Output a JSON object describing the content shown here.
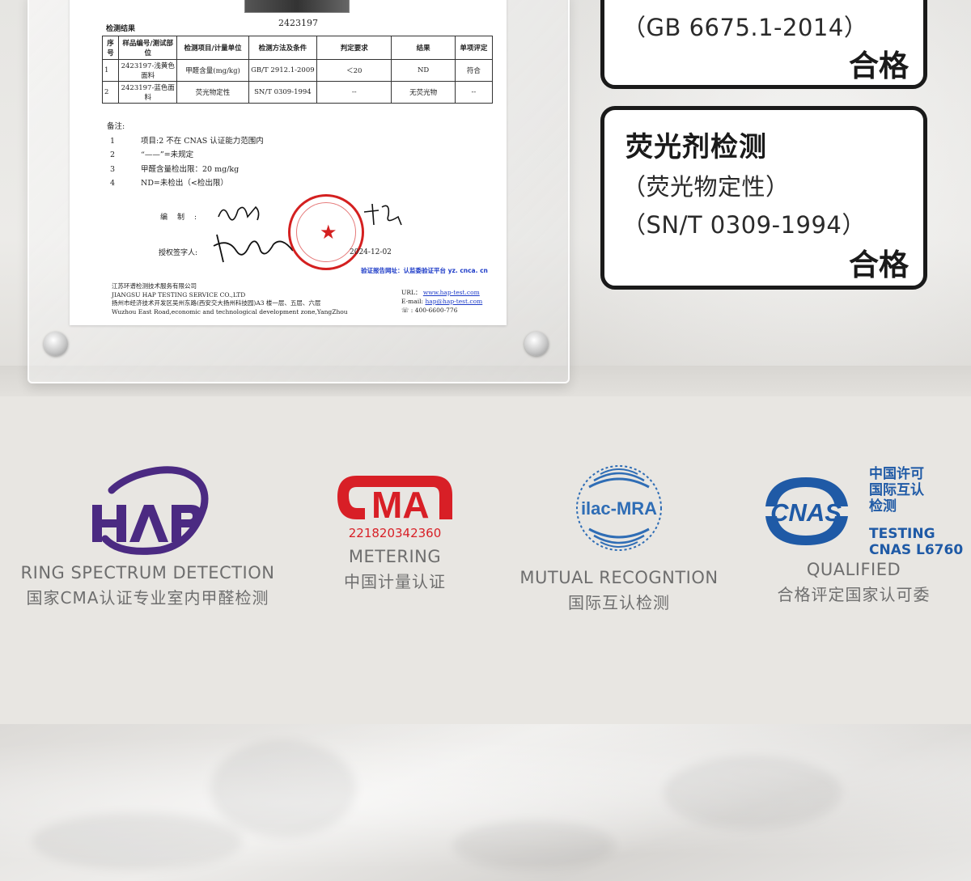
{
  "report": {
    "photo_id": "2423197",
    "section_title": "检测结果",
    "table": {
      "headers": [
        "序号",
        "样品编号/测试部位",
        "检测项目/计量单位",
        "检测方法及条件",
        "判定要求",
        "结果",
        "单项评定"
      ],
      "rows": [
        [
          "1",
          "2423197-浅黄色面料",
          "甲醛含量(mg/kg)",
          "GB/T 2912.1-2009",
          "＜20",
          "ND",
          "符合"
        ],
        [
          "2",
          "2423197-蓝色面料",
          "荧光物定性",
          "SN/T 0309-1994",
          "--",
          "无荧光物",
          "--"
        ]
      ]
    },
    "notes_title": "备注:",
    "notes": [
      {
        "num": "1",
        "text": "项目:2 不在 CNAS 认证能力范围内"
      },
      {
        "num": "2",
        "text": "“——”=未规定"
      },
      {
        "num": "3",
        "text": "甲醛含量检出限：20 mg/kg"
      },
      {
        "num": "4",
        "text": "ND=未检出（<检出限）"
      }
    ],
    "compiler_label": "编制:",
    "signatory_label": "授权签字人:",
    "date": "2024-12-02",
    "verify": "验证报告网址：认监委验证平台 yz. cnca. cn",
    "company_cn": "江苏环谱检测技术服务有限公司",
    "company_en": "JIANGSU HAP TESTING SERVICE CO.,LTD",
    "address_cn": "扬州市经济技术开发区吴州东路(西安交大扬州科技园)A3 楼一层、五层、六层",
    "address_en": "Wuzhou East Road,economic and technological development zone,YangZhou",
    "url_label": "URL：",
    "url": "www.hap-test.com",
    "email_label": "E-mail:",
    "email": "hap@hap-test.com",
    "phone": "400-6600-776"
  },
  "cards": [
    {
      "title": "",
      "lines": [
        "（GB 6675.1-2014）"
      ],
      "result": "合格"
    },
    {
      "title": "荧光剂检测",
      "lines": [
        "（荧光物定性）",
        "（SN/T 0309-1994）"
      ],
      "result": "合格"
    }
  ],
  "certs": [
    {
      "logo_text": "HAP",
      "en": "RING SPECTRUM DETECTION",
      "zh": "国家CMA认证专业室内甲醛检测",
      "color": "#4b2a82"
    },
    {
      "logo_text": "MA",
      "logo_number": "221820342360",
      "en": "METERING",
      "zh": "中国计量认证",
      "color": "#d81f26"
    },
    {
      "logo_text": "ilac-MRA",
      "en": "MUTUAL RECOGNTION",
      "zh": "国际互认检测",
      "color": "#2f6db5"
    },
    {
      "logo_text": "CNAS",
      "side_zh": [
        "中国许可",
        "国际互认",
        "检测"
      ],
      "side_en": [
        "TESTING",
        "CNAS L6760"
      ],
      "en": "QUALIFIED",
      "zh": "合格评定国家认可委",
      "color": "#1f5aa6"
    }
  ],
  "colors": {
    "card_border": "#1a1a1a",
    "stamp_red": "#d42020",
    "link_blue": "#1e3cc8",
    "caption_gray": "#6e6e6e"
  }
}
